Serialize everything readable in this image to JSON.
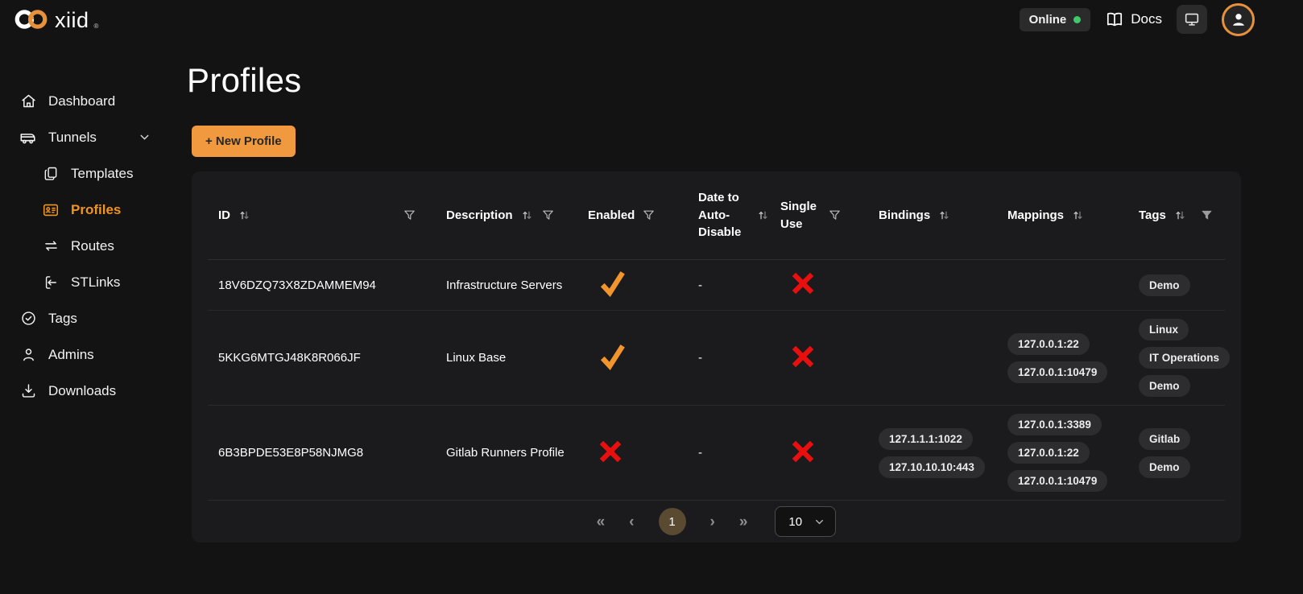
{
  "topbar": {
    "logo_text": "xiid",
    "logo_reg": "®",
    "logo_icon": "infinity-logo-icon",
    "online_label": "Online",
    "docs_label": "Docs",
    "docs_icon": "book-icon",
    "monitor_icon": "monitor-icon",
    "avatar_icon": "person-icon"
  },
  "sidebar": {
    "items": [
      {
        "label": "Dashboard",
        "icon": "home-icon",
        "active": false,
        "indent": false,
        "chevron": false
      },
      {
        "label": "Tunnels",
        "icon": "tunnel-icon",
        "active": false,
        "indent": false,
        "chevron": true
      },
      {
        "label": "Templates",
        "icon": "templates-icon",
        "active": false,
        "indent": true,
        "chevron": false
      },
      {
        "label": "Profiles",
        "icon": "profiles-icon",
        "active": true,
        "indent": true,
        "chevron": false
      },
      {
        "label": "Routes",
        "icon": "routes-icon",
        "active": false,
        "indent": true,
        "chevron": false
      },
      {
        "label": "STLinks",
        "icon": "stlinks-icon",
        "active": false,
        "indent": true,
        "chevron": false
      },
      {
        "label": "Tags",
        "icon": "tags-icon",
        "active": false,
        "indent": false,
        "chevron": false
      },
      {
        "label": "Admins",
        "icon": "admins-icon",
        "active": false,
        "indent": false,
        "chevron": false
      },
      {
        "label": "Downloads",
        "icon": "downloads-icon",
        "active": false,
        "indent": false,
        "chevron": false
      }
    ]
  },
  "main": {
    "page_title": "Profiles",
    "new_profile_button": "+ New Profile"
  },
  "table": {
    "columns": [
      {
        "label": "ID",
        "sortable": true,
        "filterable": true,
        "filter_active": false
      },
      {
        "label": "Description",
        "sortable": true,
        "filterable": true,
        "filter_active": false
      },
      {
        "label": "Enabled",
        "sortable": false,
        "filterable": true,
        "filter_active": false
      },
      {
        "label": "Date to Auto-Disable",
        "sortable": true,
        "filterable": false,
        "filter_active": false
      },
      {
        "label": "Single Use",
        "sortable": false,
        "filterable": true,
        "filter_active": false
      },
      {
        "label": "Bindings",
        "sortable": true,
        "filterable": false,
        "filter_active": false
      },
      {
        "label": "Mappings",
        "sortable": true,
        "filterable": false,
        "filter_active": false
      },
      {
        "label": "Tags",
        "sortable": true,
        "filterable": true,
        "filter_active": true
      }
    ],
    "rows": [
      {
        "id": "18V6DZQ73X8ZDAMMEM94",
        "description": "Infrastructure Servers",
        "enabled": true,
        "date_to_auto_disable": "-",
        "single_use": false,
        "bindings": [],
        "mappings": [],
        "tags": [
          "Demo"
        ]
      },
      {
        "id": "5KKG6MTGJ48K8R066JF",
        "description": "Linux Base",
        "enabled": true,
        "date_to_auto_disable": "-",
        "single_use": false,
        "bindings": [],
        "mappings": [
          "127.0.0.1:22",
          "127.0.0.1:10479"
        ],
        "tags": [
          "Linux",
          "IT Operations",
          "Demo"
        ]
      },
      {
        "id": "6B3BPDE53E8P58NJMG8",
        "description": "Gitlab Runners Profile",
        "enabled": false,
        "date_to_auto_disable": "-",
        "single_use": false,
        "bindings": [
          "127.1.1.1:1022",
          "127.10.10.10:443"
        ],
        "mappings": [
          "127.0.0.1:3389",
          "127.0.0.1:22",
          "127.0.0.1:10479"
        ],
        "tags": [
          "Gitlab",
          "Demo"
        ]
      }
    ]
  },
  "pagination": {
    "first": "«",
    "prev": "‹",
    "page": "1",
    "next": "›",
    "last": "»",
    "page_size": "10"
  },
  "colors": {
    "accent_orange": "#f0993e",
    "active_nav_orange": "#f0941f",
    "check_orange": "#f2952d",
    "error_red": "#ea0f0f",
    "online_green": "#3fc96a",
    "pill_background": "#2d2d2f",
    "table_background": "#1b1b1d",
    "page_background": "#131314",
    "active_page_circle": "#594a31"
  }
}
